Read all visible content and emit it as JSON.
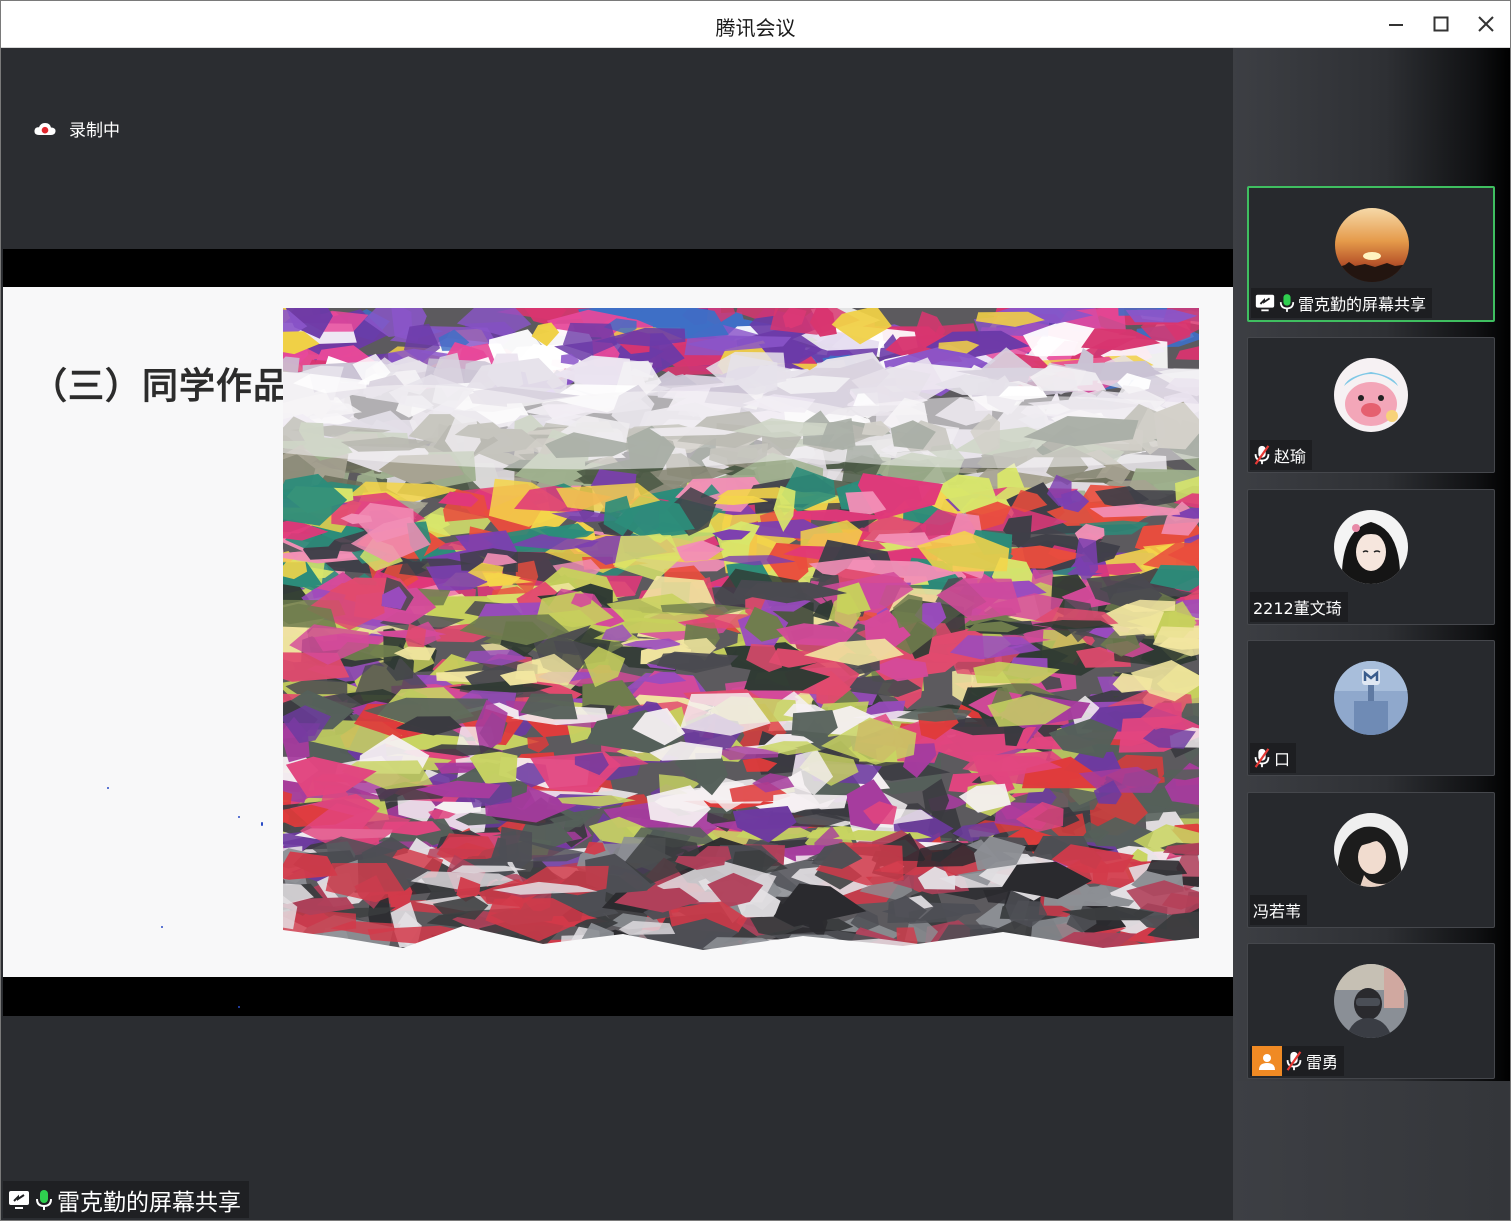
{
  "window": {
    "title": "腾讯会议"
  },
  "recording": {
    "label": "录制中"
  },
  "slide": {
    "title": "（三）同学作品"
  },
  "screen_share": {
    "label": "雷克勤的屏幕共享"
  },
  "participants": [
    {
      "name": "雷克勤的屏幕共享",
      "mic": "on",
      "sharing": true,
      "active": true
    },
    {
      "name": "赵瑜",
      "mic": "muted"
    },
    {
      "name": "2212董文琦",
      "mic": "none"
    },
    {
      "name": "口",
      "mic": "muted"
    },
    {
      "name": "冯若苇",
      "mic": "none"
    },
    {
      "name": "雷勇",
      "mic": "muted",
      "badge": "person-icon"
    }
  ],
  "colors": {
    "active_border": "#3fbf60",
    "recording_red": "#e0262d",
    "mic_green": "#2fcf4f",
    "mute_red": "#e53935",
    "badge_orange": "#f08a24"
  }
}
